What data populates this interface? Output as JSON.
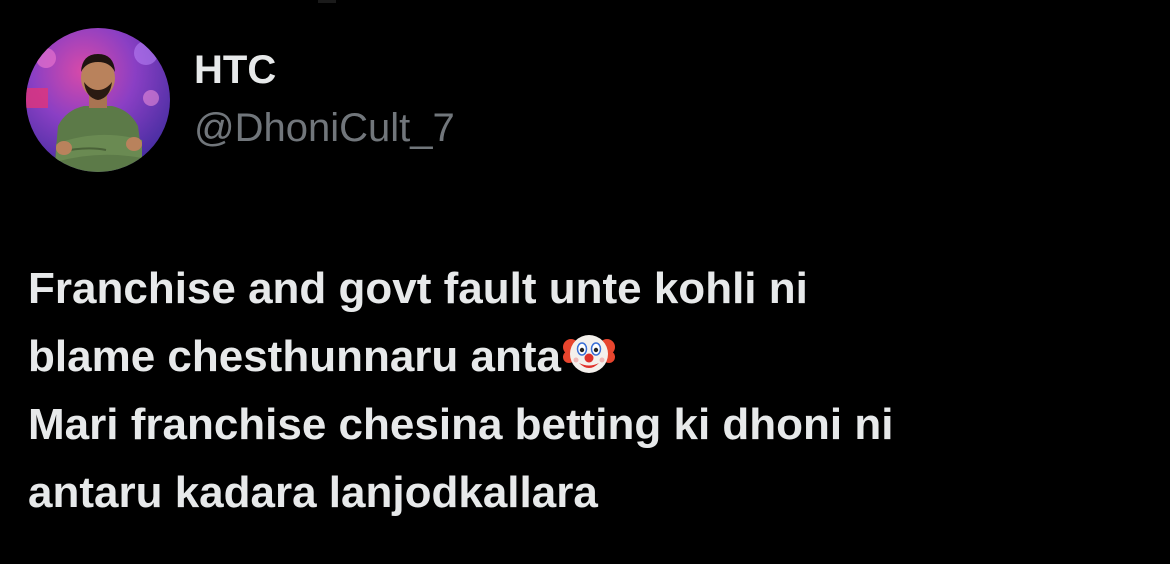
{
  "user": {
    "display_name": "HTC",
    "handle": "@DhoniCult_7",
    "avatar_icon": "profile-photo"
  },
  "tweet": {
    "lines": [
      "Franchise and govt fault unte kohli ni",
      "blame chesthunnaru anta",
      "Mari franchise chesina betting ki dhoni ni",
      "antaru kadara lanjodkallara"
    ],
    "emoji_icon": "clown-face-icon"
  },
  "colors": {
    "background": "#000000",
    "primary_text": "#e7e9ea",
    "secondary_text": "#71767b"
  }
}
